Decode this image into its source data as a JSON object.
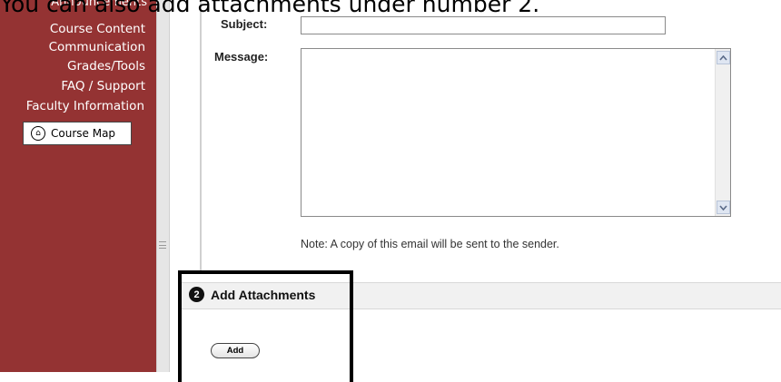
{
  "caption": "You can also add attachments under number 2.",
  "sidebar": {
    "cut_item": "Announcements",
    "items": [
      {
        "label": "Course Content"
      },
      {
        "label": "Communication"
      },
      {
        "label": "Grades/Tools"
      },
      {
        "label": "FAQ / Support"
      },
      {
        "label": "Faculty Information"
      }
    ],
    "course_map_button": "Course Map"
  },
  "form": {
    "subject_label": "Subject:",
    "subject_value": "",
    "message_label": "Message:",
    "message_value": "",
    "note": "Note: A copy of this email will be sent to the sender."
  },
  "attachments": {
    "step_number": "2",
    "title": "Add Attachments",
    "add_button": "Add"
  },
  "colors": {
    "sidebar_bg": "#943333",
    "highlight_border": "#000000"
  }
}
